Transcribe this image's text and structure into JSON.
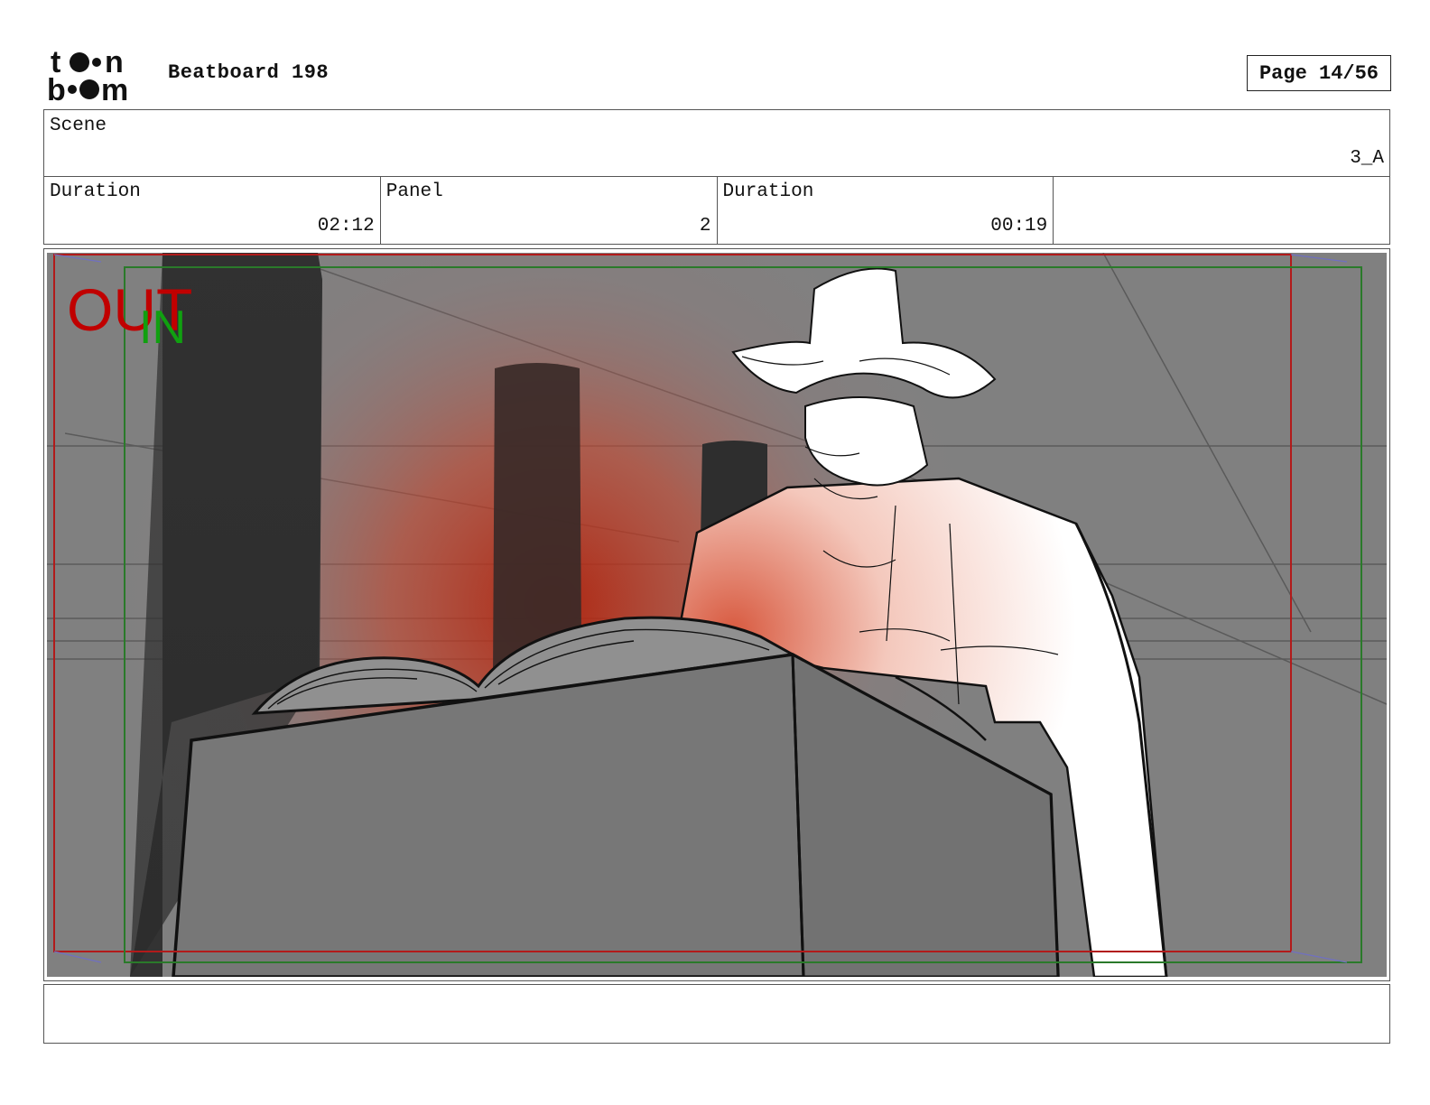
{
  "header": {
    "logo_text": "toonboom",
    "title": "Beatboard 198",
    "page_label": "Page 14/56"
  },
  "scene": {
    "label": "Scene",
    "value": "3_A"
  },
  "info_row": {
    "scene_duration_label": "Duration",
    "scene_duration_value": "02:12",
    "panel_label": "Panel",
    "panel_value": "2",
    "panel_duration_label": "Duration",
    "panel_duration_value": "00:19"
  },
  "panel_art": {
    "out_label": "OUT",
    "in_label": "IN",
    "out_color": "#c00000",
    "in_color": "#10a010",
    "background_color": "#808080"
  },
  "notes": {
    "text": ""
  }
}
